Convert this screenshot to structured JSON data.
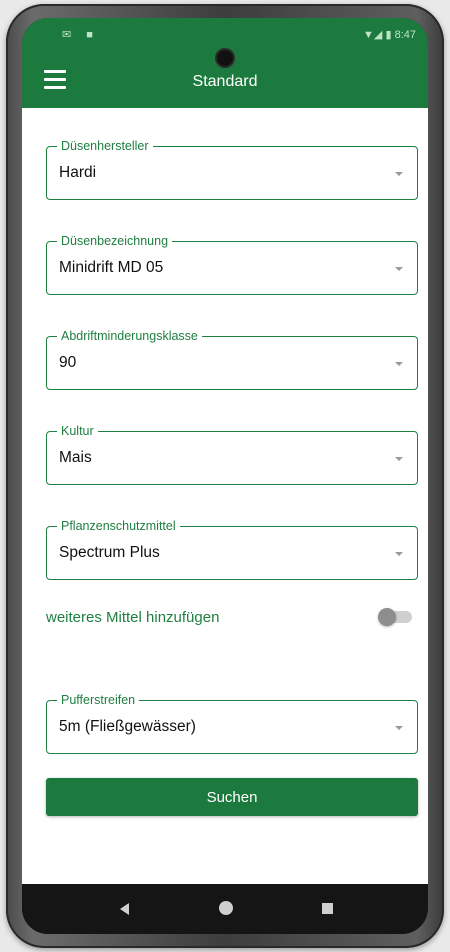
{
  "status_bar": {
    "left_icons": "✉ ■",
    "time": "8:47",
    "signal_icons": "▼◢ ▮"
  },
  "app_bar": {
    "title": "Standard",
    "menu_icon": "hamburger-menu-icon"
  },
  "form": {
    "fields": [
      {
        "label": "Düsenhersteller",
        "value": "Hardi"
      },
      {
        "label": "Düsenbezeichnung",
        "value": "Minidrift MD 05"
      },
      {
        "label": "Abdriftminderungsklasse",
        "value": "90"
      },
      {
        "label": "Kultur",
        "value": "Mais"
      },
      {
        "label": "Pflanzenschutzmittel",
        "value": "Spectrum Plus"
      }
    ],
    "toggle": {
      "label": "weiteres Mittel hinzufügen",
      "on": false
    },
    "buffer": {
      "label": "Pufferstreifen",
      "value": "5m (Fließgewässer)"
    },
    "submit_label": "Suchen"
  },
  "colors": {
    "primary": "#1d7a3e",
    "label": "#1f7f41"
  }
}
